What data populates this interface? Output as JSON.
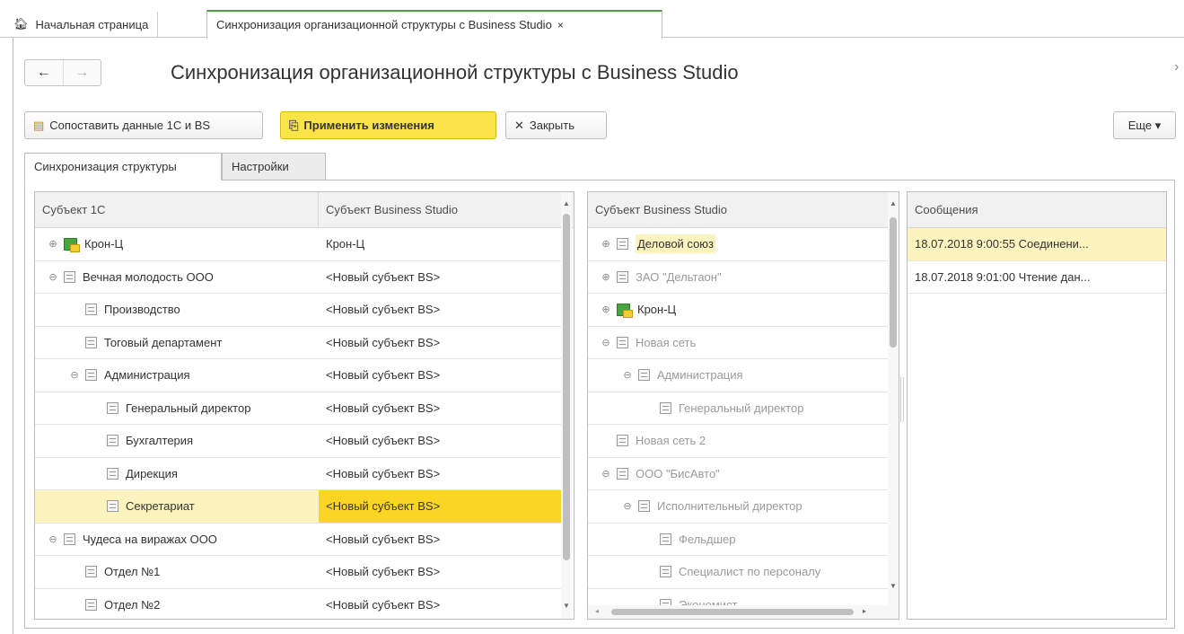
{
  "tabs": {
    "home": {
      "label": "Начальная страница",
      "icon": "home-icon"
    },
    "active": {
      "label": "Синхронизация организационной структуры с Business Studio",
      "close": "×"
    }
  },
  "nav": {
    "back": "←",
    "forward": "→"
  },
  "title": "Синхронизация организационной структуры с Business Studio",
  "toolbar": {
    "compare": "Сопоставить данные 1С и BS",
    "apply": "Применить изменения",
    "close": "Закрыть",
    "more": "Еще ▾"
  },
  "subtabs": {
    "sync": "Синхронизация структуры",
    "settings": "Настройки"
  },
  "left_table": {
    "col1": "Субъект 1С",
    "col2": "Субъект Business Studio",
    "rows": [
      {
        "level": 0,
        "toggle": "⊕",
        "icon": "key",
        "name": "Крон-Ц",
        "bs": "Крон-Ц"
      },
      {
        "level": 0,
        "toggle": "⊖",
        "icon": "doc",
        "name": "Вечная молодость ООО",
        "bs": "<Новый субъект BS>"
      },
      {
        "level": 1,
        "toggle": "",
        "icon": "doc",
        "name": "Производство",
        "bs": "<Новый субъект BS>"
      },
      {
        "level": 1,
        "toggle": "",
        "icon": "doc",
        "name": "Тоговый департамент",
        "bs": "<Новый субъект BS>"
      },
      {
        "level": 1,
        "toggle": "⊖",
        "icon": "doc",
        "name": "Администрация",
        "bs": "<Новый субъект BS>"
      },
      {
        "level": 2,
        "toggle": "",
        "icon": "doc",
        "name": "Генеральный директор",
        "bs": "<Новый субъект BS>"
      },
      {
        "level": 2,
        "toggle": "",
        "icon": "doc",
        "name": "Бухгалтерия",
        "bs": "<Новый субъект BS>"
      },
      {
        "level": 2,
        "toggle": "",
        "icon": "doc",
        "name": "Дирекция",
        "bs": "<Новый субъект BS>"
      },
      {
        "level": 2,
        "toggle": "",
        "icon": "doc",
        "name": "Секретариат",
        "bs": "<Новый субъект BS>",
        "selected": true
      },
      {
        "level": 0,
        "toggle": "⊖",
        "icon": "doc",
        "name": "Чудеса на виражах ООО",
        "bs": "<Новый субъект BS>"
      },
      {
        "level": 1,
        "toggle": "",
        "icon": "doc",
        "name": "Отдел №1",
        "bs": "<Новый субъект BS>"
      },
      {
        "level": 1,
        "toggle": "",
        "icon": "doc",
        "name": "Отдел №2",
        "bs": "<Новый субъект BS>"
      }
    ]
  },
  "middle_table": {
    "col1": "Субъект Business Studio",
    "rows": [
      {
        "level": 0,
        "toggle": "⊕",
        "icon": "doc",
        "name": "Деловой союз",
        "grey": false,
        "highlight": true
      },
      {
        "level": 0,
        "toggle": "⊕",
        "icon": "doc",
        "name": "ЗАО \"Дельтаон\"",
        "grey": true
      },
      {
        "level": 0,
        "toggle": "⊕",
        "icon": "key",
        "name": "Крон-Ц",
        "grey": false
      },
      {
        "level": 0,
        "toggle": "⊖",
        "icon": "doc",
        "name": "Новая сеть",
        "grey": true
      },
      {
        "level": 1,
        "toggle": "⊖",
        "icon": "doc",
        "name": "Администрация",
        "grey": true
      },
      {
        "level": 2,
        "toggle": "",
        "icon": "doc",
        "name": "Генеральный директор",
        "grey": true
      },
      {
        "level": 0,
        "toggle": "",
        "icon": "doc",
        "name": "Новая сеть 2",
        "grey": true
      },
      {
        "level": 0,
        "toggle": "⊖",
        "icon": "doc",
        "name": "ООО \"БисАвто\"",
        "grey": true
      },
      {
        "level": 1,
        "toggle": "⊖",
        "icon": "doc",
        "name": "Исполнительный директор",
        "grey": true
      },
      {
        "level": 2,
        "toggle": "",
        "icon": "doc",
        "name": "Фельдшер",
        "grey": true
      },
      {
        "level": 2,
        "toggle": "",
        "icon": "doc",
        "name": "Специалист по персоналу",
        "grey": true
      },
      {
        "level": 2,
        "toggle": "",
        "icon": "doc",
        "name": "Экономист",
        "grey": true
      }
    ]
  },
  "messages": {
    "header": "Сообщения",
    "rows": [
      {
        "text": "18.07.2018 9:00:55 Соединени...",
        "selected": true
      },
      {
        "text": "18.07.2018 9:01:00 Чтение дан...",
        "selected": false
      }
    ]
  },
  "colors": {
    "accent_green": "#4aa03c",
    "primary_yellow": "#fbe44a",
    "selection": "#fbd524",
    "selection_light": "#fdf3bf"
  }
}
